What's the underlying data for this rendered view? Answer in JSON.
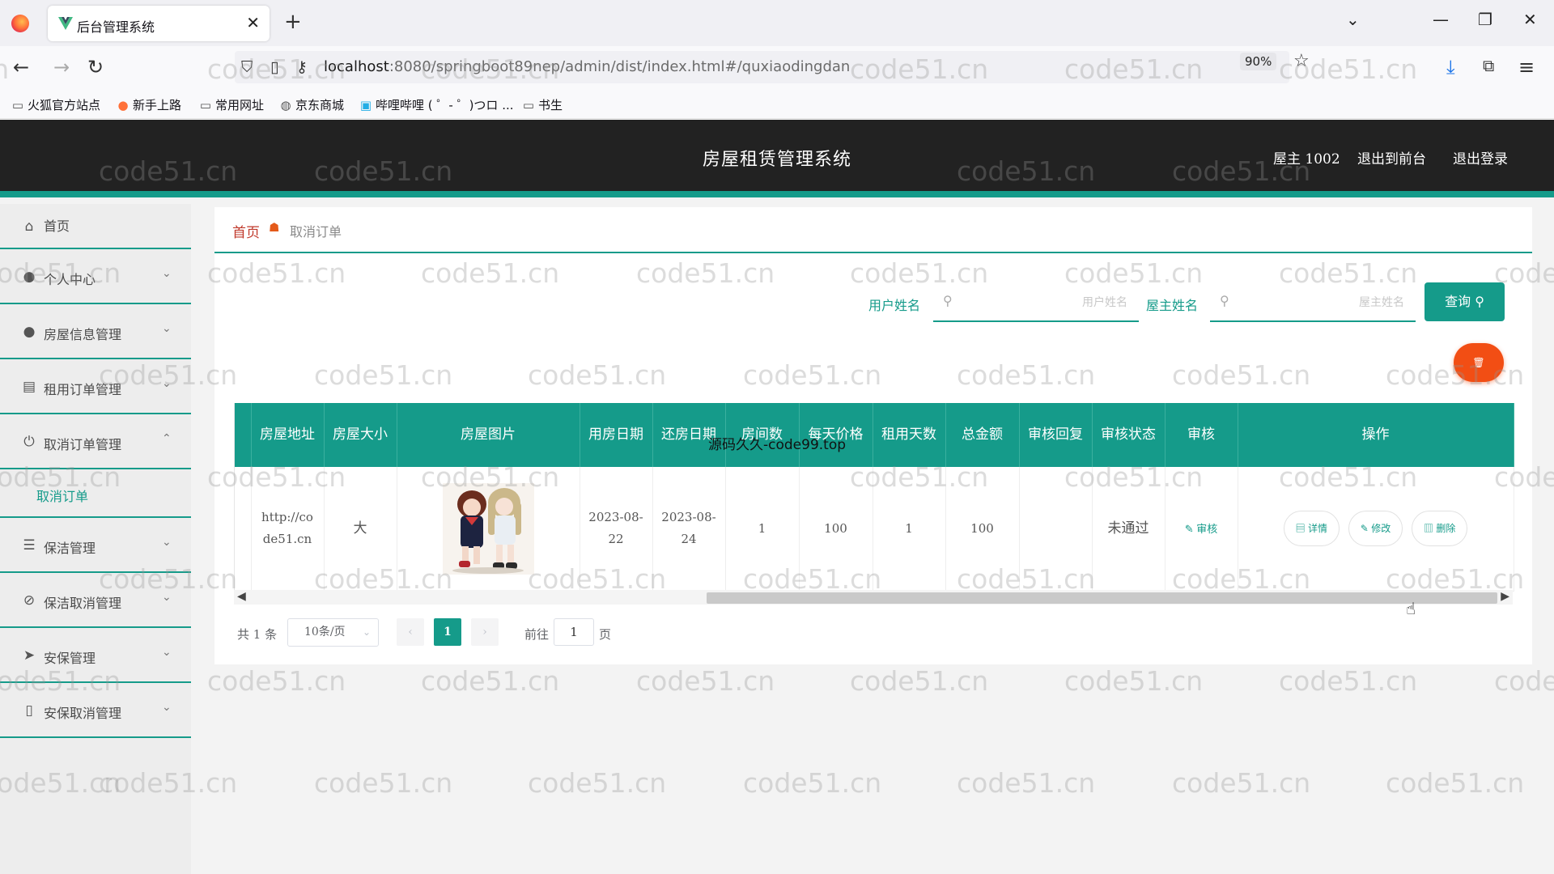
{
  "browser": {
    "tab_title": "后台管理系统",
    "url_host": "localhost",
    "url_path": ":8080/springboot89nep/admin/dist/index.html#/quxiaodingdan",
    "zoom": "90%",
    "bookmarks": [
      "火狐官方站点",
      "新手上路",
      "常用网址",
      "京东商城",
      "哔哩哔哩 ( ゜- ゜)つロ ...",
      "书生"
    ]
  },
  "header": {
    "title": "房屋租赁管理系统",
    "user": "屋主 1002",
    "to_front": "退出到前台",
    "logout": "退出登录"
  },
  "sidebar": {
    "items": [
      {
        "label": "首页",
        "icon": "home-icon"
      },
      {
        "label": "个人中心",
        "icon": "user-icon"
      },
      {
        "label": "房屋信息管理",
        "icon": "user-icon"
      },
      {
        "label": "租用订单管理",
        "icon": "briefcase-icon"
      },
      {
        "label": "取消订单管理",
        "icon": "power-icon"
      },
      {
        "label": "保洁管理",
        "icon": "list-icon"
      },
      {
        "label": "保洁取消管理",
        "icon": "compass-icon"
      },
      {
        "label": "安保管理",
        "icon": "send-icon"
      },
      {
        "label": "安保取消管理",
        "icon": "phone-icon"
      }
    ],
    "sub_item": "取消订单"
  },
  "breadcrumb": {
    "home": "首页",
    "current": "取消订单"
  },
  "search": {
    "user_label": "用户姓名",
    "user_placeholder": "用户姓名",
    "owner_label": "屋主姓名",
    "owner_placeholder": "屋主姓名",
    "query_button": "查询"
  },
  "table": {
    "headers": [
      "房屋地址",
      "房屋大小",
      "房屋图片",
      "用房日期",
      "还房日期",
      "房间数",
      "每天价格",
      "租用天数",
      "总金额",
      "审核回复",
      "审核状态",
      "审核",
      "操作"
    ],
    "rows": [
      {
        "address": "http://code51.cn",
        "size": "大",
        "start_date": "2023-08-22",
        "end_date": "2023-08-24",
        "rooms": "1",
        "daily_price": "100",
        "days": "1",
        "total": "100",
        "reply": "",
        "status": "未通过",
        "audit": "审核",
        "actions": {
          "detail": "详情",
          "edit": "修改",
          "delete": "删除"
        }
      }
    ]
  },
  "overlay_text": "源码久久-code99.top",
  "pagination": {
    "total": "共 1 条",
    "page_size": "10条/页",
    "current_page": "1",
    "goto_label": "前往",
    "goto_value": "1",
    "goto_unit": "页"
  },
  "watermark": "code51.cn"
}
